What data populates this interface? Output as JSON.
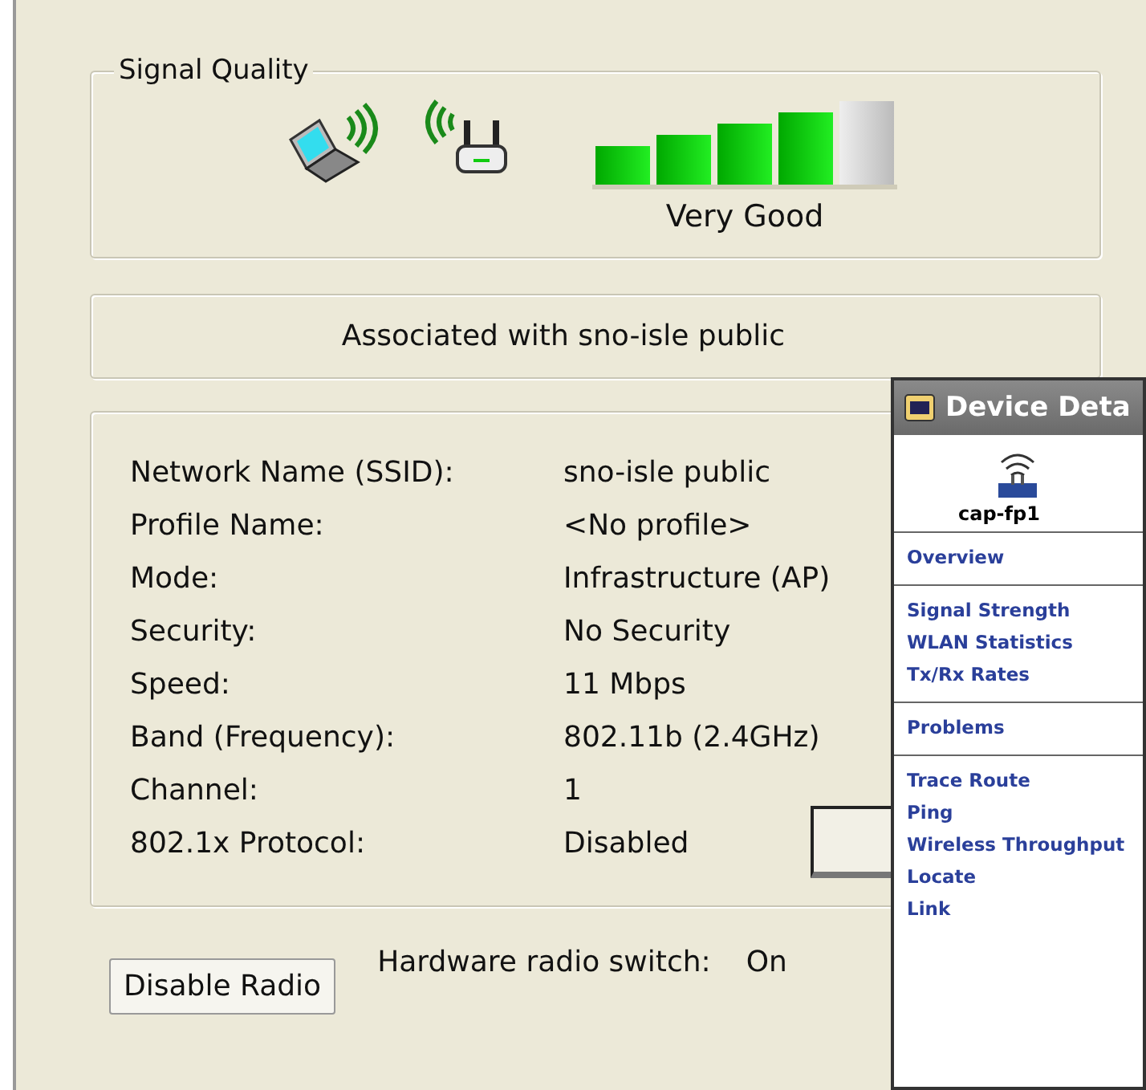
{
  "signal_quality": {
    "title": "Signal Quality",
    "rating": "Very Good"
  },
  "association": "Associated with sno-isle public",
  "details": [
    {
      "label": "Network Name (SSID):",
      "value": "sno-isle public"
    },
    {
      "label": "Profile Name:",
      "value": "<No profile>"
    },
    {
      "label": "Mode:",
      "value": "Infrastructure (AP)"
    },
    {
      "label": "Security:",
      "value": "No Security"
    },
    {
      "label": "Speed:",
      "value": "11 Mbps"
    },
    {
      "label": "Band (Frequency):",
      "value": "802.11b (2.4GHz)"
    },
    {
      "label": "Channel:",
      "value": "1"
    },
    {
      "label": "802.1x Protocol:",
      "value": "Disabled"
    }
  ],
  "disable_radio_button": {
    "label": "Disable Radio",
    "disabled": false
  },
  "hardware_switch": {
    "label": "Hardware radio switch:",
    "value": "On"
  },
  "device_details_window": {
    "title": "Device Deta",
    "device": "cap-fp1",
    "sections": [
      [
        "Overview"
      ],
      [
        "Signal Strength",
        "WLAN Statistics",
        "Tx/Rx Rates"
      ],
      [
        "Problems"
      ],
      [
        "Trace Route",
        "Ping",
        "Wireless Throughput",
        "Locate",
        "Link"
      ]
    ]
  }
}
